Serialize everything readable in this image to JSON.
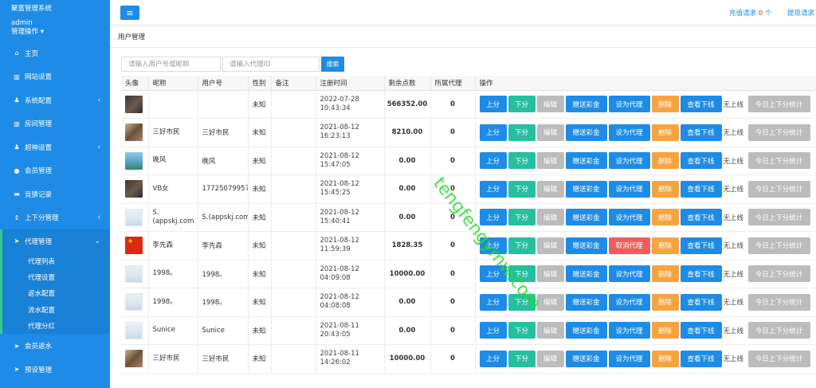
{
  "sidebar": {
    "brand": "聚富管理系统",
    "username": "admin",
    "user_menu": "管理操作",
    "items": [
      {
        "label": "主页",
        "icon": "home-icon",
        "glyph": "⌂",
        "arrow": ""
      },
      {
        "label": "网站设置",
        "icon": "book-icon",
        "glyph": "▥",
        "arrow": ""
      },
      {
        "label": "系统配置",
        "icon": "user-gear-icon",
        "glyph": "♟",
        "arrow": "‹"
      },
      {
        "label": "房间管理",
        "icon": "book-icon",
        "glyph": "▥",
        "arrow": ""
      },
      {
        "label": "超神设置",
        "icon": "user-gear-icon",
        "glyph": "♟",
        "arrow": "‹"
      },
      {
        "label": "会员管理",
        "icon": "user-icon",
        "glyph": "●",
        "arrow": ""
      },
      {
        "label": "竞猜记录",
        "icon": "car-icon",
        "glyph": "▬",
        "arrow": ""
      },
      {
        "label": "上下分管理",
        "icon": "updown-icon",
        "glyph": "↕",
        "arrow": "‹"
      },
      {
        "label": "代理管理",
        "icon": "send-icon",
        "glyph": "➤",
        "arrow": "⌄"
      }
    ],
    "subitems": [
      "代理列表",
      "代理设置",
      "返水配置",
      "流水配置",
      "代理分红"
    ],
    "bottom_items": [
      {
        "label": "会员返水",
        "icon": "send-icon",
        "glyph": "➤"
      },
      {
        "label": "预设管理",
        "icon": "send-icon",
        "glyph": "➤"
      }
    ]
  },
  "topbar": {
    "menu_glyph": "≡",
    "recharge_label": "充值请求",
    "recharge_count": "0",
    "recharge_unit": "个",
    "withdraw_label": "提现请求"
  },
  "panel": {
    "title": "用户管理",
    "search_user_placeholder": "请输入用户号或昵称",
    "search_agent_placeholder": "请输入代理ID",
    "search_button": "搜索"
  },
  "table": {
    "headers": [
      "头像",
      "昵称",
      "用户号",
      "性别",
      "备注",
      "注册时间",
      "剩余点数",
      "所属代理",
      "操作"
    ],
    "actions": {
      "up": "上分",
      "down": "下分",
      "edit": "编辑",
      "gift": "赠送彩金",
      "set_agent": "设为代理",
      "cancel_agent": "取消代理",
      "delete": "删除",
      "view_sub": "查看下线",
      "no_sub": "无上线",
      "stats": "今日上下分统计"
    },
    "rows": [
      {
        "avatar": "dark",
        "nickname": "",
        "user_no": "",
        "gender": "未知",
        "note": "",
        "date": "2022-07-28",
        "time": "10:43:34",
        "points": "566352.00",
        "agent": "0",
        "is_agent": false
      },
      {
        "avatar": "man",
        "nickname": "三好市民",
        "user_no": "三好市民",
        "gender": "未知",
        "note": "",
        "date": "2021-08-12",
        "time": "16:23:13",
        "points": "8210.00",
        "agent": "0",
        "is_agent": false
      },
      {
        "avatar": "sea",
        "nickname": "晚风",
        "user_no": "晚风",
        "gender": "未知",
        "note": "",
        "date": "2021-08-12",
        "time": "15:47:05",
        "points": "0.00",
        "agent": "0",
        "is_agent": false
      },
      {
        "avatar": "dark",
        "nickname": "VB女",
        "user_no": "17725079957",
        "gender": "未知",
        "note": "",
        "date": "2021-08-12",
        "time": "15:45:25",
        "points": "0.00",
        "agent": "0",
        "is_agent": false
      },
      {
        "avatar": "ph",
        "nickname": "S.(appskj.com",
        "user_no": "S.(appskj.com",
        "gender": "未知",
        "note": "",
        "date": "2021-08-12",
        "time": "15:40:41",
        "points": "0.00",
        "agent": "0",
        "is_agent": false
      },
      {
        "avatar": "flag",
        "nickname": "李先森",
        "user_no": "李先森",
        "gender": "未知",
        "note": "",
        "date": "2021-08-12",
        "time": "11:59:39",
        "points": "1828.35",
        "agent": "0",
        "is_agent": true
      },
      {
        "avatar": "ph",
        "nickname": "1998。",
        "user_no": "1998。",
        "gender": "未知",
        "note": "",
        "date": "2021-08-12",
        "time": "04:09:08",
        "points": "10000.00",
        "agent": "0",
        "is_agent": false
      },
      {
        "avatar": "ph",
        "nickname": "1998。",
        "user_no": "1998。",
        "gender": "未知",
        "note": "",
        "date": "2021-08-12",
        "time": "04:08:08",
        "points": "0.00",
        "agent": "0",
        "is_agent": false
      },
      {
        "avatar": "ph",
        "nickname": "Sunice",
        "user_no": "Sunice",
        "gender": "未知",
        "note": "",
        "date": "2021-08-11",
        "time": "20:43:05",
        "points": "0.00",
        "agent": "0",
        "is_agent": false
      },
      {
        "avatar": "man",
        "nickname": "三好市民",
        "user_no": "三好市民",
        "gender": "未知",
        "note": "",
        "date": "2021-08-11",
        "time": "14:26:02",
        "points": "10000.00",
        "agent": "0",
        "is_agent": false
      }
    ]
  },
  "watermark": "tengfengymw.com",
  "colors": {
    "primary": "#1e8ce6",
    "teal": "#26bfa0",
    "gray": "#bcbcbc",
    "red": "#f05c5c",
    "orange": "#f6a43f",
    "active_indicator": "#38c98a"
  }
}
